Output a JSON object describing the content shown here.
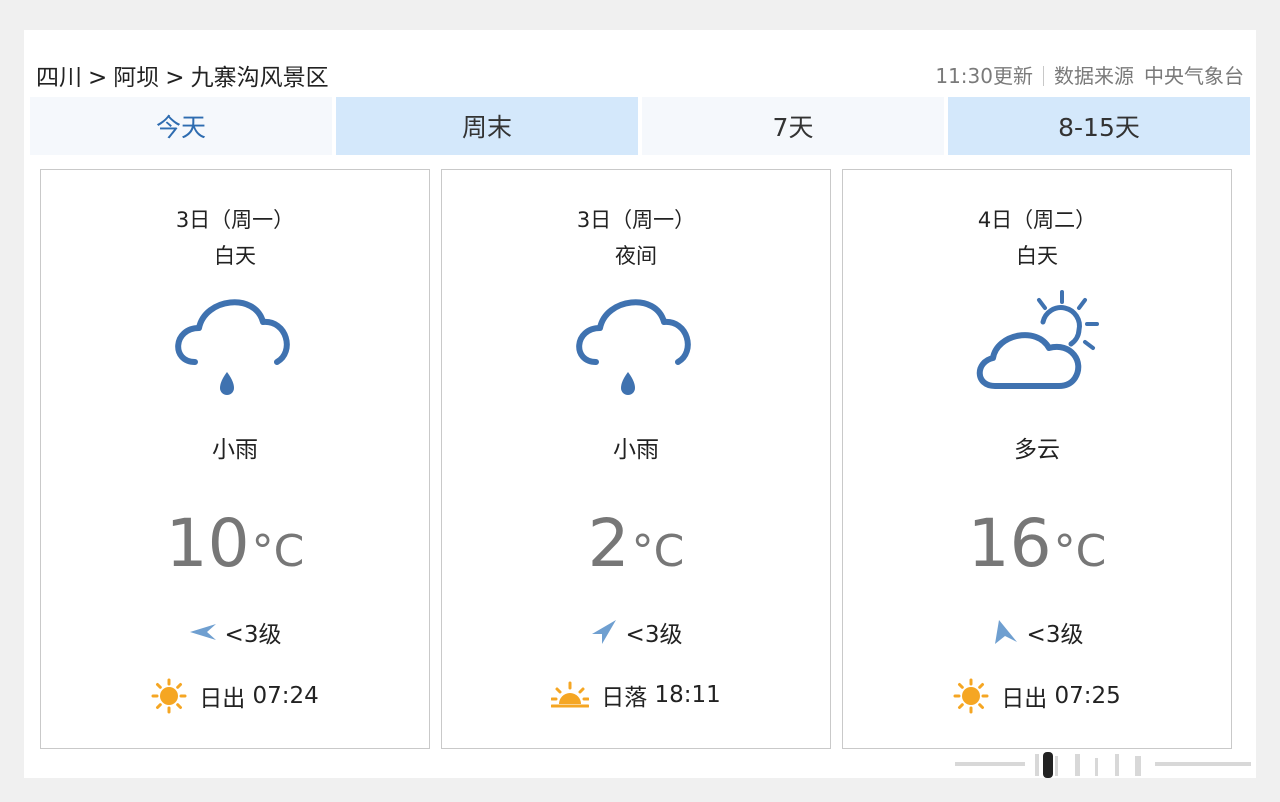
{
  "breadcrumb": {
    "province": "四川",
    "separator": ">",
    "prefecture": "阿坝",
    "area": "九寨沟风景区"
  },
  "update": {
    "time": "11:30更新",
    "source_label": "数据来源",
    "source": "中央气象台"
  },
  "tabs": [
    {
      "label": "今天",
      "active": true
    },
    {
      "label": "周末",
      "active": false
    },
    {
      "label": "7天",
      "active": false
    },
    {
      "label": "8-15天",
      "active": false
    }
  ],
  "cards": [
    {
      "date": "3日（周一）",
      "period": "白天",
      "icon": "light-rain-icon",
      "condition": "小雨",
      "temp": "10",
      "unit": "°C",
      "wind_icon": "wind-direction-arrow-icon",
      "wind": "<3级",
      "sun_icon": "sunrise-icon",
      "sun_label": "日出",
      "sun_time": "07:24"
    },
    {
      "date": "3日（周一）",
      "period": "夜间",
      "icon": "light-rain-icon",
      "condition": "小雨",
      "temp": "2",
      "unit": "°C",
      "wind_icon": "wind-direction-arrow-icon",
      "wind": "<3级",
      "sun_icon": "sunset-icon",
      "sun_label": "日落",
      "sun_time": "18:11"
    },
    {
      "date": "4日（周二）",
      "period": "白天",
      "icon": "partly-cloudy-icon",
      "condition": "多云",
      "temp": "16",
      "unit": "°C",
      "wind_icon": "wind-direction-arrow-icon",
      "wind": "<3级",
      "sun_icon": "sunrise-icon",
      "sun_label": "日出",
      "sun_time": "07:25"
    }
  ],
  "colors": {
    "accent": "#2e6cb0",
    "tab_blue": "#d4e8fb",
    "tab_light": "#f5f8fc",
    "icon_blue": "#3f72b0",
    "sun_orange": "#f5a623"
  }
}
